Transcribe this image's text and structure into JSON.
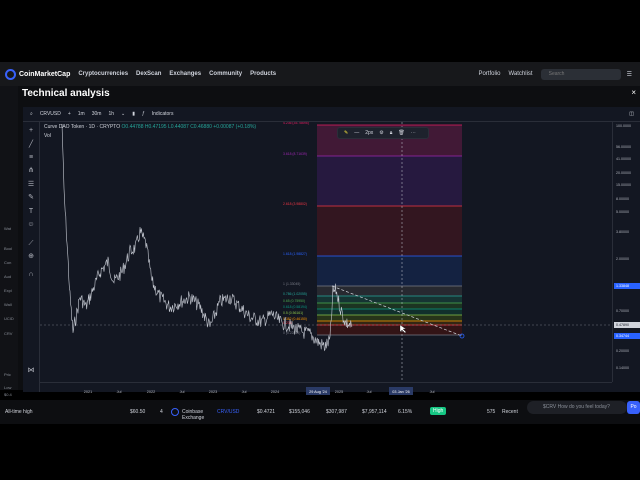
{
  "cmc_nav": {
    "logo": "CoinMarketCap",
    "items": [
      "Cryptocurrencies",
      "DexScan",
      "Exchanges",
      "Community",
      "Products"
    ],
    "right": {
      "portfolio": "Portfolio",
      "watchlist": "Watchlist",
      "search_placeholder": "Search",
      "search_key": "/"
    }
  },
  "modal": {
    "title": "Technical analysis",
    "close": "×"
  },
  "side_strip": [
    "Wat",
    "Bool",
    "Con",
    "Aud",
    "Expl",
    "Wall",
    "UCID",
    "CRV",
    "Pric",
    "Low",
    "$0.4"
  ],
  "toolbar": {
    "symbol": "CRVUSD",
    "add": "+",
    "intervals": [
      "1m",
      "30m",
      "1h"
    ],
    "indicators": "Indicators"
  },
  "legend": {
    "title": "Curve DAO Token · 1D · CRYPTO",
    "ohlc": "O0.44788 H0.47195 L0.44087 C0.46880 +0.00087 (+0.18%)",
    "vol": "Vol"
  },
  "draw_toolbar": {
    "width_label": "2px"
  },
  "fib_levels": [
    {
      "label": "4.236 (35.78695)",
      "color": "#e91e63"
    },
    {
      "label": "3.618 (8.71639)",
      "color": "#9c27b0"
    },
    {
      "label": "2.618 (3.98802)",
      "color": "#f23645"
    },
    {
      "label": "1.618 (1.98827)",
      "color": "#2962ff"
    },
    {
      "label": "1 (1.33045)",
      "color": "#787b86"
    },
    {
      "label": "0.786 (1.02055)",
      "color": "#26a69a"
    },
    {
      "label": "0.65 (0.75950)",
      "color": "#4caf50"
    },
    {
      "label": "0.618 (0.58194)",
      "color": "#089981"
    },
    {
      "label": "0.5 (0.56161)",
      "color": "#8bc34a"
    },
    {
      "label": "0.382 (0.46150)",
      "color": "#ff9800"
    },
    {
      "label": "0.236",
      "color": "#f23645"
    },
    {
      "label": "0 (0.22813)",
      "color": "#787b86"
    }
  ],
  "price_scale": [
    "100.0000",
    "56.00000",
    "41.00000",
    "20.00000",
    "15.00000",
    "8.00000",
    "5.00000",
    "3.80000",
    "2.00000",
    "1.33848",
    "0.70000",
    "0.47890",
    "0.34744",
    "0.20000",
    "0.14000"
  ],
  "time_axis": [
    "2021",
    "Jul",
    "2022",
    "Jul",
    "2023",
    "Jul",
    "2024",
    "29 Aug '24",
    "2025",
    "Jul",
    "03 Jan '26",
    "Jul"
  ],
  "bottom_row": {
    "left": "All-time high",
    "value1": "$60.50",
    "rank": "4",
    "exchange": "Coinbase Exchange",
    "pair": "CRV/USD",
    "price": "$0.4721",
    "depth_plus": "$155,046",
    "depth_minus": "$307,987",
    "volume": "$7,957,114",
    "volume_pct": "6.15%",
    "liquidity": "High",
    "score": "575",
    "updated": "Recent"
  },
  "chat": {
    "placeholder": "$CRV How do you feel today?",
    "button": "Po"
  }
}
